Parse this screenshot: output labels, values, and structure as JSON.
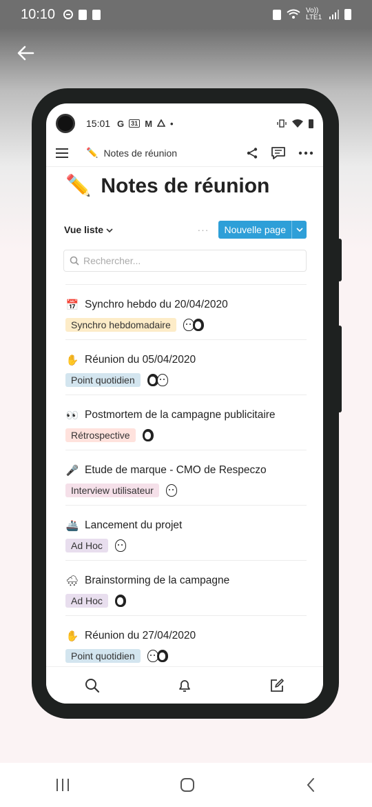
{
  "device_status": {
    "time": "10:10",
    "network": "Vo)) LTE1"
  },
  "inner_status": {
    "time": "15:01",
    "app_icons": [
      "G",
      "31",
      "M"
    ]
  },
  "topbar": {
    "page_emoji": "✏️",
    "page_title": "Notes de réunion"
  },
  "page": {
    "emoji": "✏️",
    "title": "Notes de réunion"
  },
  "viewbar": {
    "view_label": "Vue liste",
    "more": "···",
    "new_page_label": "Nouvelle page"
  },
  "search": {
    "placeholder": "Rechercher..."
  },
  "items": [
    {
      "emoji": "📅",
      "title": "Synchro hebdo du 20/04/2020",
      "tag": "Synchro hebdomadaire",
      "tag_color": "#fdecc8",
      "avatars": 2
    },
    {
      "emoji": "✋",
      "title": "Réunion du 05/04/2020",
      "tag": "Point quotidien",
      "tag_color": "#d3e5ef",
      "avatars": 2
    },
    {
      "emoji": "👀",
      "title": "Postmortem de la campagne publicitaire",
      "tag": "Rétrospective",
      "tag_color": "#ffe2dd",
      "avatars": 1
    },
    {
      "emoji": "🎤",
      "title": "Etude de marque - CMO de Respeczo",
      "tag": "Interview utilisateur",
      "tag_color": "#f5e0e9",
      "avatars": 1
    },
    {
      "emoji": "🚢",
      "title": "Lancement du projet",
      "tag": "Ad Hoc",
      "tag_color": "#e8deee",
      "avatars": 1
    },
    {
      "emoji": "🌨",
      "title": "Brainstorming de la campagne",
      "tag": "Ad Hoc",
      "tag_color": "#e8deee",
      "avatars": 1
    },
    {
      "emoji": "✋",
      "title": "Réunion du 27/04/2020",
      "tag": "Point quotidien",
      "tag_color": "#d3e5ef",
      "avatars": 2
    }
  ],
  "icons": {
    "back": "back-arrow-icon",
    "menu": "hamburger-menu-icon",
    "share": "share-icon",
    "comments": "comment-icon",
    "more": "more-horizontal-icon",
    "search": "search-icon",
    "notifications": "bell-icon",
    "new": "compose-icon"
  },
  "colors": {
    "accent": "#2e9fd8"
  }
}
